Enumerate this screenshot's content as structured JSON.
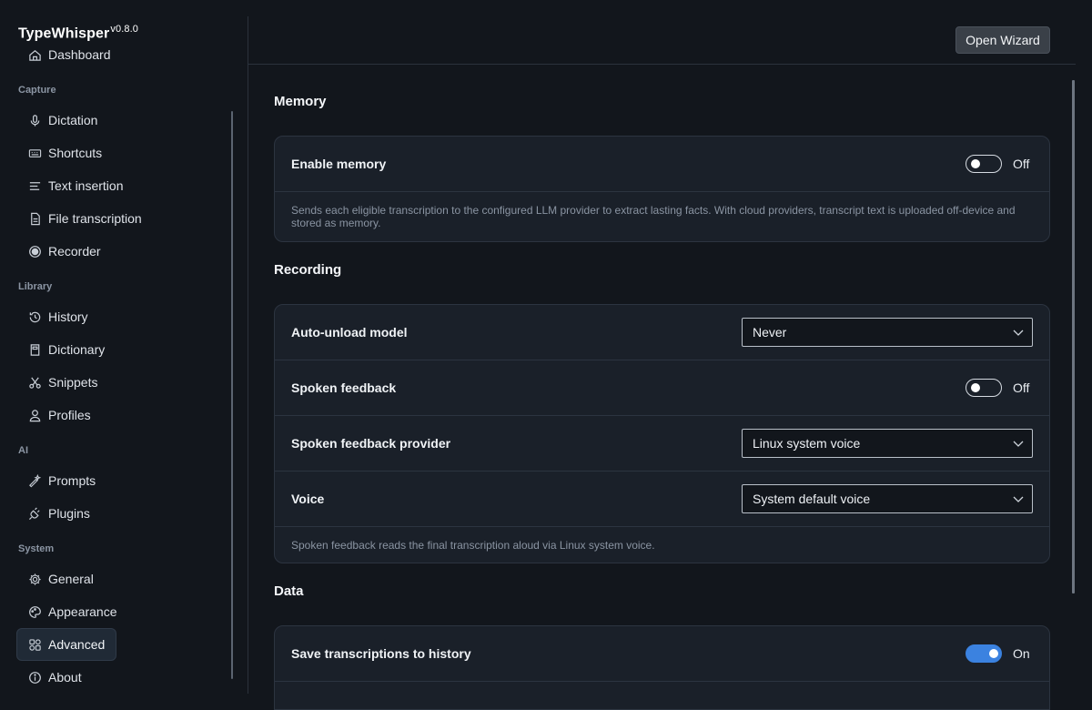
{
  "app": {
    "name": "TypeWhisper",
    "version": "v0.8.0"
  },
  "sidebar": {
    "partial_item": {
      "label": "Dashboard",
      "icon": "dashboard-icon"
    },
    "sections": [
      {
        "label": "Capture",
        "items": [
          {
            "label": "Dictation",
            "icon": "mic-icon"
          },
          {
            "label": "Shortcuts",
            "icon": "keyboard-icon"
          },
          {
            "label": "Text insertion",
            "icon": "text-lines-icon"
          },
          {
            "label": "File transcription",
            "icon": "file-icon"
          },
          {
            "label": "Recorder",
            "icon": "record-icon"
          }
        ]
      },
      {
        "label": "Library",
        "items": [
          {
            "label": "History",
            "icon": "history-icon"
          },
          {
            "label": "Dictionary",
            "icon": "book-icon"
          },
          {
            "label": "Snippets",
            "icon": "scissors-icon"
          },
          {
            "label": "Profiles",
            "icon": "user-icon"
          }
        ]
      },
      {
        "label": "AI",
        "items": [
          {
            "label": "Prompts",
            "icon": "sparkle-icon"
          },
          {
            "label": "Plugins",
            "icon": "plug-icon"
          }
        ]
      },
      {
        "label": "System",
        "items": [
          {
            "label": "General",
            "icon": "gear-icon"
          },
          {
            "label": "Appearance",
            "icon": "palette-icon"
          },
          {
            "label": "Advanced",
            "icon": "advanced-icon",
            "active": true
          },
          {
            "label": "About",
            "icon": "info-icon"
          }
        ]
      }
    ]
  },
  "header": {
    "wizard_label": "Open Wizard"
  },
  "memory": {
    "title": "Memory",
    "enable_label": "Enable memory",
    "enable_state": "Off",
    "note": "Sends each eligible transcription to the configured LLM provider to extract lasting facts. With cloud providers, transcript text is uploaded off-device and stored as memory."
  },
  "recording": {
    "title": "Recording",
    "auto_unload_label": "Auto-unload model",
    "auto_unload_value": "Never",
    "spoken_feedback_label": "Spoken feedback",
    "spoken_feedback_state": "Off",
    "provider_label": "Spoken feedback provider",
    "provider_value": "Linux system voice",
    "voice_label": "Voice",
    "voice_value": "System default voice",
    "note": "Spoken feedback reads the final transcription aloud via Linux system voice."
  },
  "data": {
    "title": "Data",
    "save_history_label": "Save transcriptions to history",
    "save_history_state": "On"
  },
  "colors": {
    "accent": "#3b82e0",
    "background": "#12161c",
    "card": "#1a2029"
  }
}
